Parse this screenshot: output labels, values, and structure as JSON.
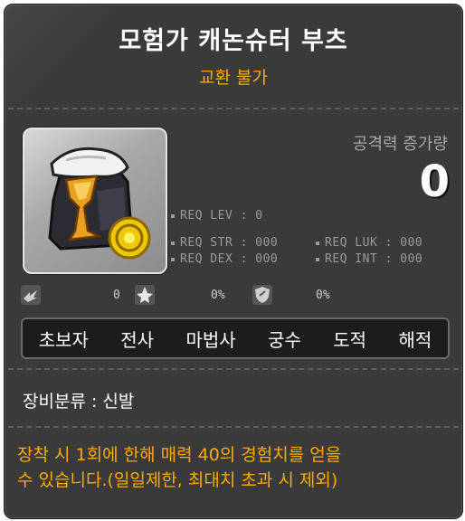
{
  "item": {
    "name": "모험가 캐논슈터 부츠",
    "trade_status": "교환 불가",
    "attack_increase_label": "공격력 증가량",
    "attack_increase_value": "0"
  },
  "requirements": {
    "lev": "REQ LEV :   0",
    "str": "REQ STR : 000",
    "dex": "REQ DEX : 000",
    "luk": "REQ LUK : 000",
    "int": "REQ INT : 000"
  },
  "stat_icons": [
    {
      "icon": "upgrade-slots-icon",
      "value": "0"
    },
    {
      "icon": "star-force-icon",
      "value": "0%"
    },
    {
      "icon": "shield-icon",
      "value": "0%"
    }
  ],
  "jobs": [
    "초보자",
    "전사",
    "마법사",
    "궁수",
    "도적",
    "해적"
  ],
  "category": "장비분류 : 신발",
  "description": {
    "line1": "장착 시 1회에 한해 매력 40의 경험치를 얻을",
    "line2": "수 있습니다.(일일제한, 최대치 초과 시 제외)"
  },
  "colors": {
    "background": "#3a3a3a",
    "title": "#ffffff",
    "accent_orange": "#ffaa00",
    "muted_text": "#9a9a9a"
  }
}
